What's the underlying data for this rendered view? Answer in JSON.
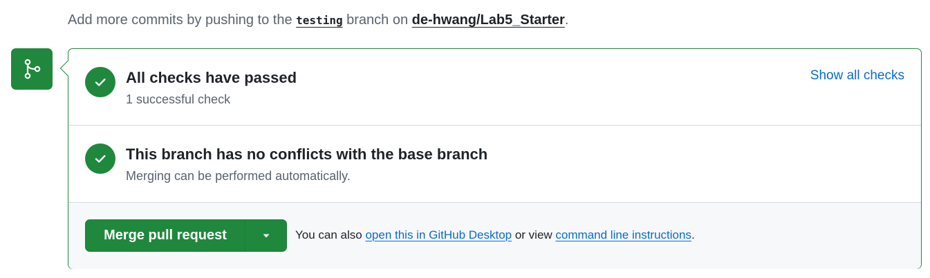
{
  "hint": {
    "prefix": "Add more commits by pushing to the ",
    "branch": "testing",
    "middle": " branch on ",
    "repo": "de-hwang/Lab5_Starter",
    "suffix": "."
  },
  "checks": {
    "title": "All checks have passed",
    "subtitle": "1 successful check",
    "show_all_label": "Show all checks"
  },
  "conflicts": {
    "title": "This branch has no conflicts with the base branch",
    "subtitle": "Merging can be performed automatically."
  },
  "merge": {
    "button_label": "Merge pull request",
    "also_prefix": "You can also ",
    "desktop_link": "open this in GitHub Desktop",
    "also_middle": " or view ",
    "cli_link": "command line instructions",
    "also_suffix": "."
  },
  "icons": {
    "merge": "git-merge-icon",
    "check": "check-icon",
    "caret": "triangle-down-icon"
  },
  "colors": {
    "success": "#1f883d",
    "link": "#0969da",
    "muted": "#59636e"
  }
}
